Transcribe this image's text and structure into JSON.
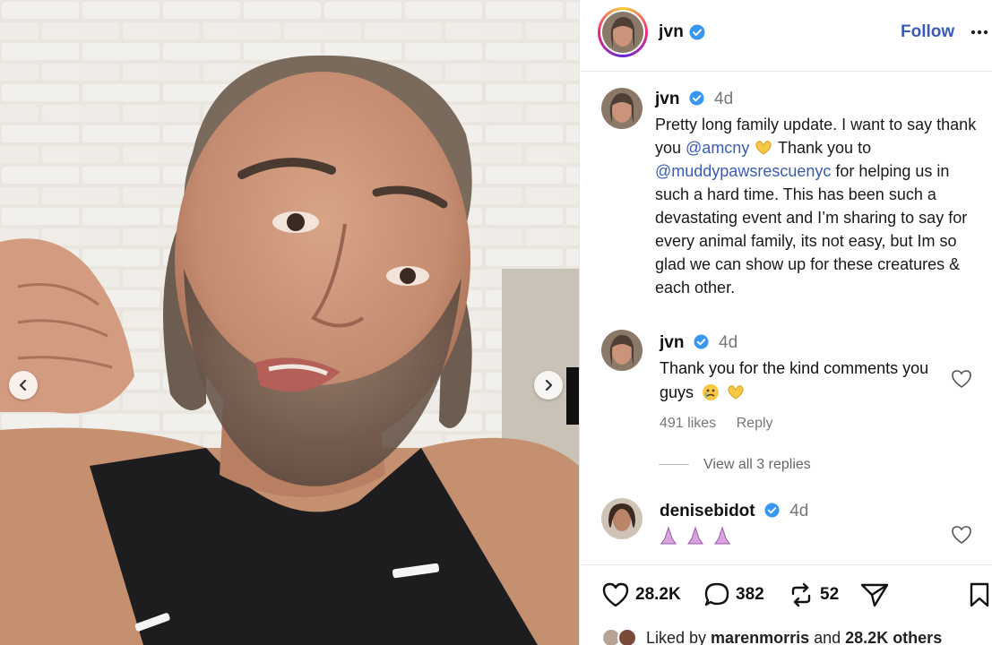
{
  "post": {
    "author": "jvn",
    "follow_label": "Follow"
  },
  "caption": {
    "author": "jvn",
    "time": "4d",
    "text_1": "Pretty long family update. I want to say thank you ",
    "mention_1": "@amcny",
    "text_2": " Thank you to ",
    "mention_2": "@muddypawsrescuenyc",
    "text_3": " for helping us in such a hard time. This has been such a devastating event and I’m sharing to say for every animal family, its not easy, but Im so glad we can show up for these creatures & each other."
  },
  "comments": [
    {
      "author": "jvn",
      "time": "4d",
      "text": "Thank you for the kind comments you guys",
      "likes": "491 likes",
      "reply_label": "Reply"
    },
    {
      "author": "denisebidot",
      "time": "4d",
      "text": ""
    }
  ],
  "view_replies": "View all 3 replies",
  "stats": {
    "likes": "28.2K",
    "comments": "382",
    "reposts": "52"
  },
  "liked_by": {
    "prefix": "Liked by ",
    "user": "marenmorris",
    "middle": " and ",
    "others": "28.2K others"
  },
  "colors": {
    "link": "#3a5bb8",
    "verified": "#3897f0",
    "meta": "#777777"
  },
  "icons": {
    "prev": "chevron-left-icon",
    "next": "chevron-right-icon",
    "verified": "verified-badge-icon",
    "more": "more-horizontal-icon",
    "heart": "heart-icon",
    "comment": "comment-bubble-icon",
    "repost": "repost-icon",
    "share": "paper-plane-icon",
    "save": "bookmark-icon"
  }
}
